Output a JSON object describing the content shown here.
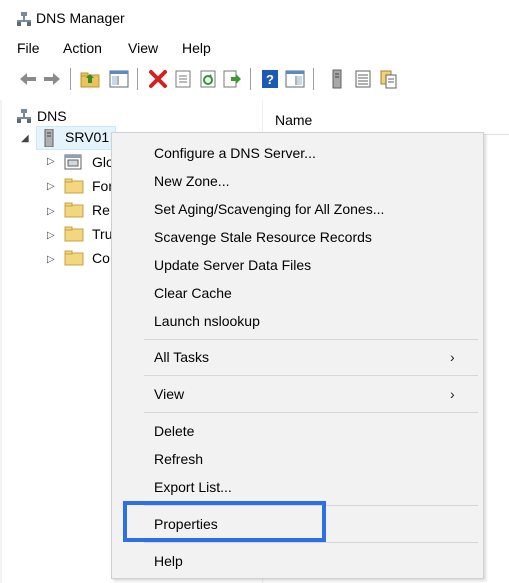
{
  "window": {
    "title": "DNS Manager"
  },
  "menubar": {
    "items": [
      "File",
      "Action",
      "View",
      "Help"
    ]
  },
  "toolbar": {
    "icons": [
      "back-arrow-icon",
      "forward-arrow-icon",
      "up-folder-icon",
      "show-hide-console-tree-icon",
      "delete-icon",
      "properties-icon",
      "refresh-icon",
      "export-list-icon",
      "help-icon",
      "show-action-pane-icon",
      "server-icon",
      "list-view-icon",
      "copy-records-icon"
    ]
  },
  "tree": {
    "root": "DNS",
    "server": "SRV01",
    "children": [
      "Glo",
      "For",
      "Re",
      "Tru",
      "Co"
    ]
  },
  "list": {
    "column_header": "Name"
  },
  "context_menu": {
    "configure": "Configure a DNS Server...",
    "new_zone": "New Zone...",
    "set_aging": "Set Aging/Scavenging for All Zones...",
    "scavenge": "Scavenge Stale Resource Records",
    "update_files": "Update Server Data Files",
    "clear_cache": "Clear Cache",
    "nslookup": "Launch nslookup",
    "all_tasks": "All Tasks",
    "view": "View",
    "delete": "Delete",
    "refresh": "Refresh",
    "export_list": "Export List...",
    "properties": "Properties",
    "help": "Help",
    "submenu_arrow": "›"
  },
  "colors": {
    "highlight_box": "#2f6fe6",
    "menu_background": "#f2f2f2",
    "selection": "#e5f3fb"
  }
}
